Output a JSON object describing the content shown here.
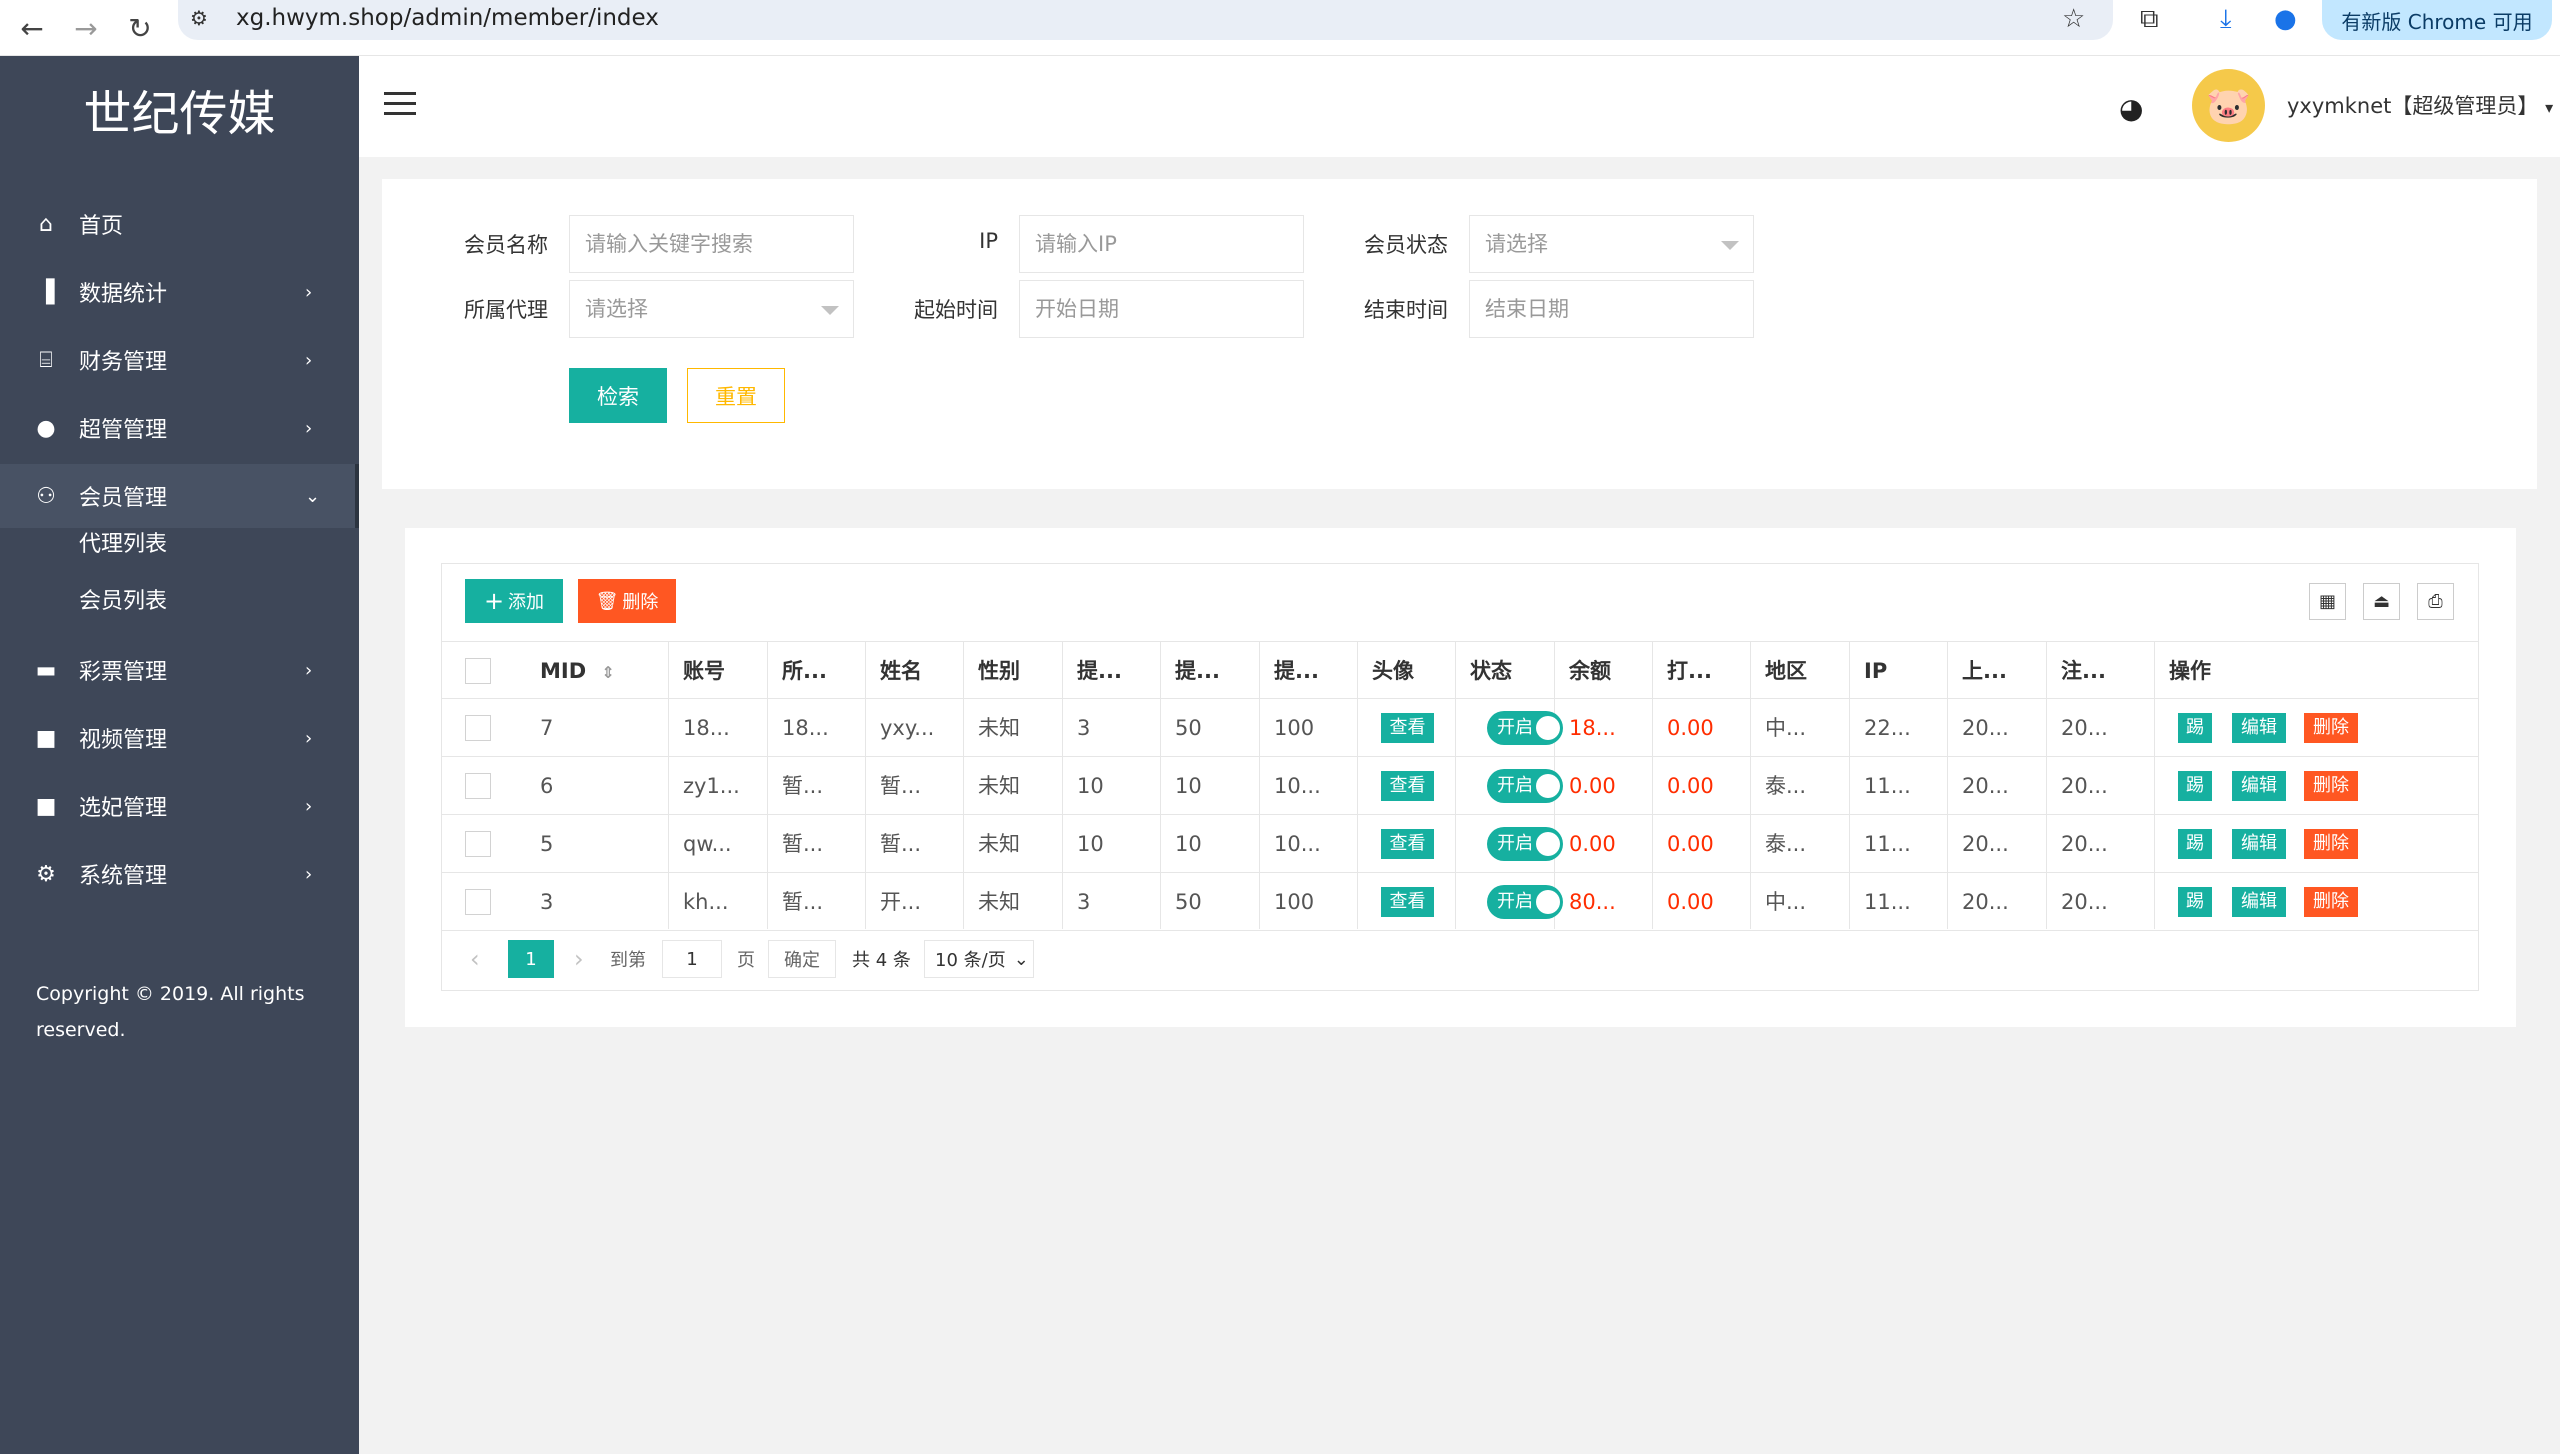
{
  "browser": {
    "url": "xg.hwym.shop/admin/member/index",
    "update_label": "有新版 Chrome 可用"
  },
  "sidebar": {
    "logo": "世纪传媒",
    "items": [
      {
        "label": "首页",
        "icon": "home-icon",
        "arrow": ""
      },
      {
        "label": "数据统计",
        "icon": "bar-chart-icon",
        "arrow": "›"
      },
      {
        "label": "财务管理",
        "icon": "bank-icon",
        "arrow": "›"
      },
      {
        "label": "超管管理",
        "icon": "user-icon",
        "arrow": "›"
      },
      {
        "label": "会员管理",
        "icon": "users-icon",
        "arrow": "⌄"
      },
      {
        "label": "彩票管理",
        "icon": "gamepad-icon",
        "arrow": "›"
      },
      {
        "label": "视频管理",
        "icon": "video-icon",
        "arrow": "›"
      },
      {
        "label": "选妃管理",
        "icon": "video-icon",
        "arrow": "›"
      },
      {
        "label": "系统管理",
        "icon": "gear-icon",
        "arrow": "›"
      }
    ],
    "submenu": [
      "代理列表",
      "会员列表"
    ],
    "copyright": "Copyright © 2019. All rights reserved."
  },
  "header": {
    "username": "yxymknet【超级管理员】"
  },
  "search_form": {
    "member_name_label": "会员名称",
    "member_name_placeholder": "请输入关键字搜索",
    "ip_label": "IP",
    "ip_placeholder": "请输入IP",
    "status_label": "会员状态",
    "status_value": "请选择",
    "agent_label": "所属代理",
    "agent_value": "请选择",
    "start_label": "起始时间",
    "start_placeholder": "开始日期",
    "end_label": "结束时间",
    "end_placeholder": "结束日期",
    "search_button": "检索",
    "reset_button": "重置"
  },
  "toolbar": {
    "add_label": "添加",
    "delete_label": "删除"
  },
  "table": {
    "headers": [
      "MID",
      "账号",
      "所...",
      "姓名",
      "性别",
      "提...",
      "提...",
      "提...",
      "头像",
      "状态",
      "余额",
      "打...",
      "地区",
      "IP",
      "上...",
      "注...",
      "操作"
    ],
    "rows": [
      {
        "mid": "7",
        "account": "18...",
        "agent": "18...",
        "name": "yxy...",
        "gender": "未知",
        "c5": "3",
        "c6": "50",
        "c7": "100",
        "avatar": "查看",
        "status": "开启",
        "balance": "18...",
        "bet": "0.00",
        "region": "中...",
        "ip": "22...",
        "last": "20...",
        "reg": "20..."
      },
      {
        "mid": "6",
        "account": "zy1...",
        "agent": "暂...",
        "name": "暂...",
        "gender": "未知",
        "c5": "10",
        "c6": "10",
        "c7": "10...",
        "avatar": "查看",
        "status": "开启",
        "balance": "0.00",
        "bet": "0.00",
        "region": "泰...",
        "ip": "11...",
        "last": "20...",
        "reg": "20..."
      },
      {
        "mid": "5",
        "account": "qw...",
        "agent": "暂...",
        "name": "暂...",
        "gender": "未知",
        "c5": "10",
        "c6": "10",
        "c7": "10...",
        "avatar": "查看",
        "status": "开启",
        "balance": "0.00",
        "bet": "0.00",
        "region": "泰...",
        "ip": "11...",
        "last": "20...",
        "reg": "20..."
      },
      {
        "mid": "3",
        "account": "kh...",
        "agent": "暂...",
        "name": "开...",
        "gender": "未知",
        "c5": "3",
        "c6": "50",
        "c7": "100",
        "avatar": "查看",
        "status": "开启",
        "balance": "80...",
        "bet": "0.00",
        "region": "中...",
        "ip": "11...",
        "last": "20...",
        "reg": "20..."
      }
    ],
    "ops": [
      "踢",
      "编辑",
      "删除"
    ]
  },
  "pager": {
    "current": "1",
    "goto_label": "到第",
    "goto_value": "1",
    "page_unit": "页",
    "confirm": "确定",
    "total": "共 4 条",
    "page_size": "10 条/页"
  },
  "colors": {
    "sidebar": "#3e4758",
    "primary": "#16b0a0",
    "danger": "#ff5722",
    "warning": "#ffb800",
    "red_text": "#ff2d00"
  }
}
